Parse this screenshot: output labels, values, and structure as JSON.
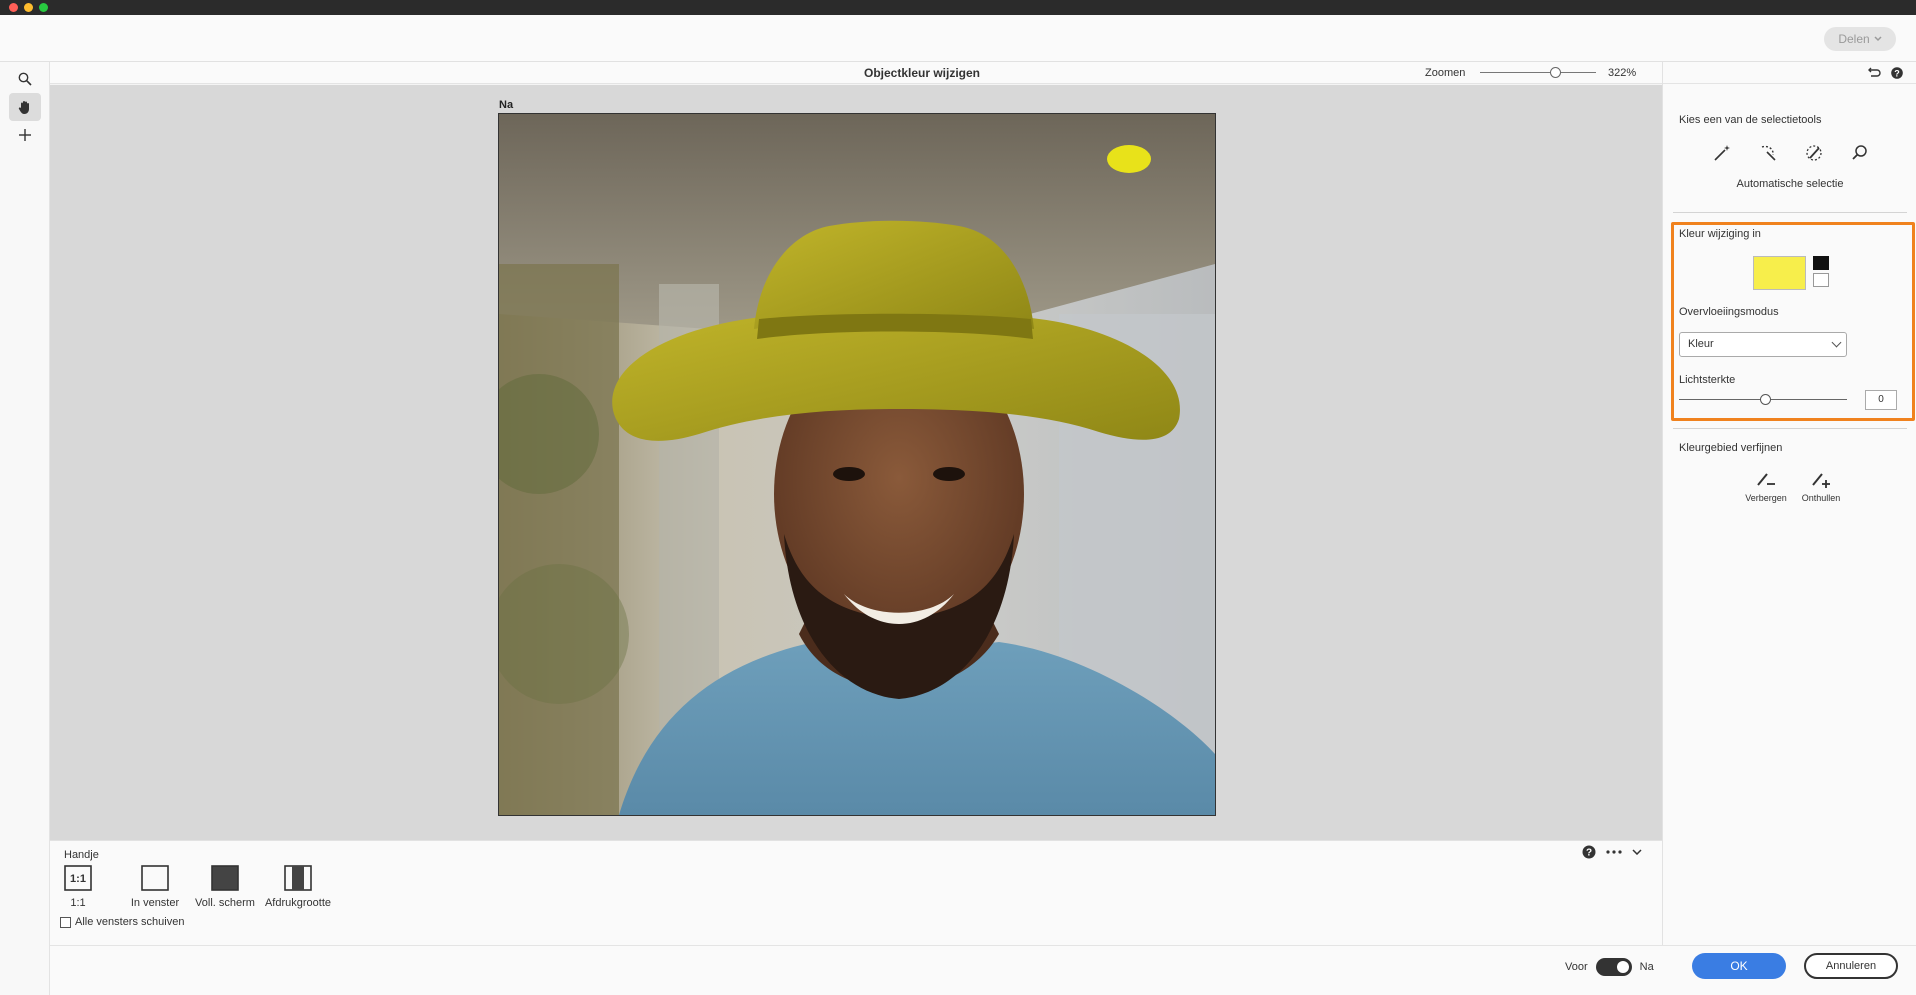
{
  "window": {
    "traffic_lights": [
      "#ff5f57",
      "#febc2e",
      "#28c840"
    ]
  },
  "appbar": {
    "share_label": "Delen"
  },
  "left_tools": [
    "zoom-tool",
    "hand-tool",
    "add-tool"
  ],
  "header": {
    "title": "Objectkleur wijzigen",
    "zoom_label": "Zoomen",
    "zoom_value": "322%",
    "zoom_fraction": 0.62
  },
  "canvas": {
    "view_label": "Na"
  },
  "bottom_panel": {
    "tool_name": "Handje",
    "options": [
      {
        "label": "1:1",
        "icon": "one-to-one-icon"
      },
      {
        "label": "In venster",
        "icon": "fit-window-icon"
      },
      {
        "label": "Voll. scherm",
        "icon": "fill-screen-icon"
      },
      {
        "label": "Afdrukgrootte",
        "icon": "print-size-icon"
      }
    ],
    "checkbox_label": "Alle vensters schuiven",
    "checkbox_checked": false
  },
  "footer": {
    "before_label": "Voor",
    "after_label": "Na",
    "toggle_on": true,
    "ok_label": "OK",
    "cancel_label": "Annuleren"
  },
  "right_panel": {
    "selection_heading": "Kies een van de selectietools",
    "selection_tools": [
      "magic-wand-icon",
      "quick-selection-icon",
      "brush-selection-icon",
      "search-icon"
    ],
    "auto_select_label": "Automatische selectie",
    "color_change_heading": "Kleur wijziging in",
    "selected_color": "#f7ee4b",
    "blend_mode_heading": "Overvloeiingsmodus",
    "blend_mode_value": "Kleur",
    "brightness_heading": "Lichtsterkte",
    "brightness_value": "0",
    "refine_heading": "Kleurgebied verfijnen",
    "refine_hide_label": "Verbergen",
    "refine_reveal_label": "Onthullen"
  }
}
